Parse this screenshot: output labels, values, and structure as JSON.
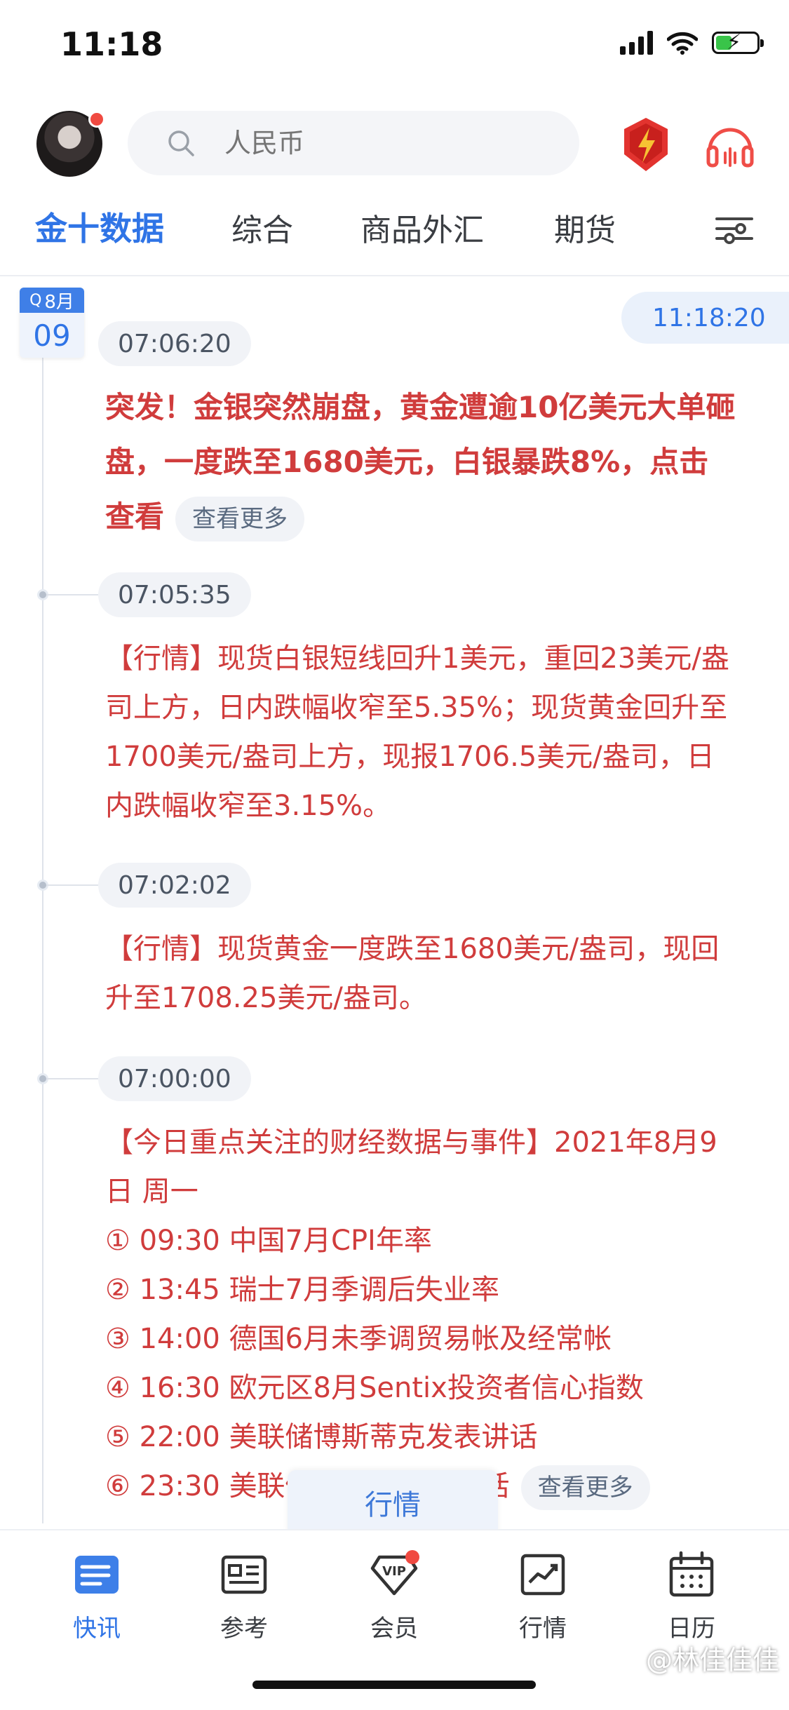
{
  "status_bar": {
    "time": "11:18"
  },
  "header": {
    "search_placeholder": "人民币"
  },
  "tabs": [
    {
      "label": "金十数据",
      "active": true
    },
    {
      "label": "综合",
      "active": false
    },
    {
      "label": "商品外汇",
      "active": false
    },
    {
      "label": "期货",
      "active": false
    }
  ],
  "date_badge": {
    "month": "8月",
    "day": "09"
  },
  "current_time": "11:18:20",
  "news": [
    {
      "time": "07:06:20",
      "text": "突发！金银突然崩盘，黄金遭逾10亿美元大单砸盘，一度跌至1680美元，白银暴跌8%，点击查看",
      "more": "查看更多"
    },
    {
      "time": "07:05:35",
      "text": "【行情】现货白银短线回升1美元，重回23美元/盎司上方，日内跌幅收窄至5.35%；现货黄金回升至1700美元/盎司上方，现报1706.5美元/盎司，日内跌幅收窄至3.15%。"
    },
    {
      "time": "07:02:02",
      "text": "【行情】现货黄金一度跌至1680美元/盎司，现回升至1708.25美元/盎司。"
    },
    {
      "time": "07:00:00",
      "heading": "【今日重点关注的财经数据与事件】2021年8月9日 周一",
      "items": [
        "① 09:30 中国7月CPI年率",
        "② 13:45 瑞士7月季调后失业率",
        "③ 14:00 德国6月未季调贸易帐及经常帐",
        "④ 16:30 欧元区8月Sentix投资者信心指数",
        "⑤ 22:00 美联储博斯蒂克发表讲话",
        "⑥ 23:30 美联储巴尔金发表讲话"
      ],
      "more": "查看更多"
    }
  ],
  "float_tab": "行情",
  "bottom_nav": [
    {
      "label": "快讯",
      "icon": "news-icon",
      "active": true
    },
    {
      "label": "参考",
      "icon": "reference-icon",
      "active": false
    },
    {
      "label": "会员",
      "icon": "vip-icon",
      "active": false
    },
    {
      "label": "行情",
      "icon": "market-chart-icon",
      "active": false
    },
    {
      "label": "日历",
      "icon": "calendar-icon",
      "active": false
    }
  ],
  "watermark": "@林佳佳佳",
  "colors": {
    "accent": "#2f74e6",
    "news_red": "#d03c3c",
    "badge_red": "#f04a41"
  }
}
